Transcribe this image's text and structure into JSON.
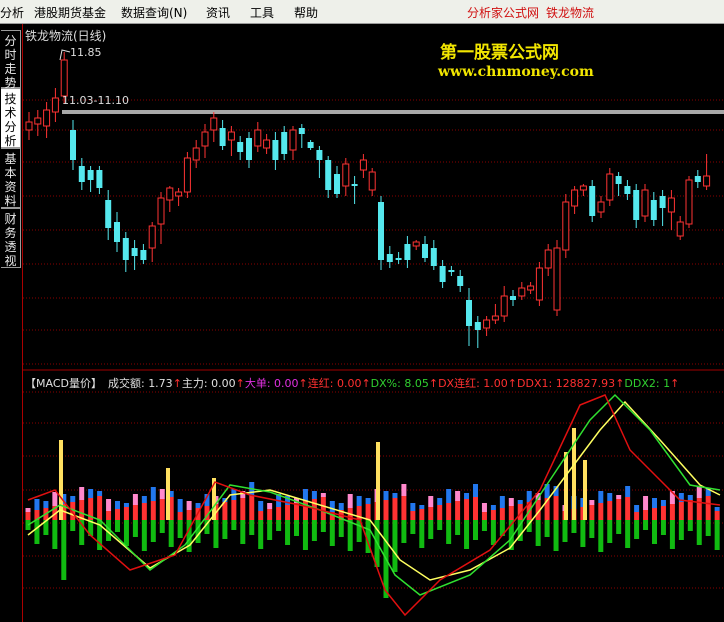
{
  "menu": {
    "items": [
      "分析",
      "港股期货基金",
      "数据查询(N)",
      "资讯",
      "工具",
      "帮助"
    ],
    "right_text_1": "分析家公式网",
    "right_text_2": "铁龙物流"
  },
  "side_tabs": [
    "分时走势",
    "技术分析",
    "基本资料",
    "财务透视"
  ],
  "price_chart": {
    "title": "铁龙物流(日线)",
    "high_label": "11.85",
    "range_label": "11.03-11.10"
  },
  "watermark": {
    "line1": "第一股票公式网",
    "line2": "www.chnmoney.com"
  },
  "indicator_bar": {
    "name": "【MACD量价】",
    "items": [
      {
        "label": "成交额:",
        "value": "1.73",
        "color": "#e0e0e0"
      },
      {
        "label": "主力:",
        "value": "0.00",
        "color": "#e0e0e0"
      },
      {
        "label": "大单:",
        "value": "0.00",
        "color": "#e030e0"
      },
      {
        "label": "连红:",
        "value": "0.00",
        "color": "#ff3030"
      },
      {
        "label": "DX%:",
        "value": "8.05",
        "color": "#30d030"
      },
      {
        "label": "DX连红:",
        "value": "1.00",
        "color": "#ff3030"
      },
      {
        "label": "DDX1:",
        "value": "128827.93",
        "color": "#ff3030"
      },
      {
        "label": "DDX2:",
        "value": "1",
        "color": "#30d030"
      }
    ]
  },
  "colors": {
    "up": "#ff3333",
    "down": "#55e8ee",
    "grid": "#8a0000",
    "yellow_line": "#ffff60",
    "green_line": "#30e030",
    "red_line": "#e01010",
    "pink_cap": "#ff88cc",
    "blue_bar": "#2277ee",
    "green_bar": "#11bb11"
  }
}
